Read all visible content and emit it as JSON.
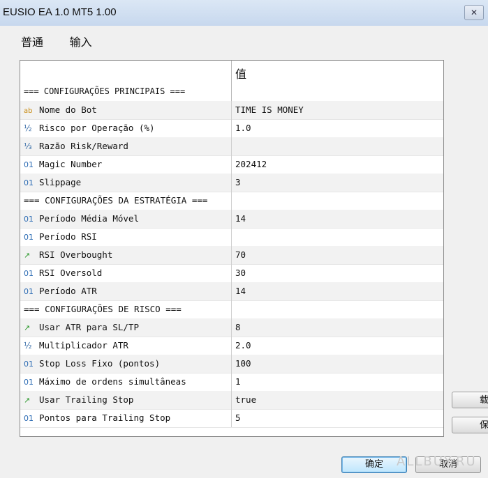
{
  "window": {
    "title": "EUSIO EA 1.0 MT5 1.00",
    "close_glyph": "✕"
  },
  "tabs": [
    {
      "label": "普通"
    },
    {
      "label": "输入"
    }
  ],
  "grid": {
    "value_header": "值",
    "section_main": "=== CONFIGURAÇÕES PRINCIPAIS ===",
    "rows": [
      {
        "icon": "ab",
        "name": "Nome do Bot",
        "value": "TIME IS MONEY"
      },
      {
        "icon": "½",
        "name": "Risco por Operação (%)",
        "value": "1.0"
      },
      {
        "icon": "⅓",
        "name": "Razão Risk/Reward",
        "value": ""
      },
      {
        "icon": "01",
        "name": "Magic Number",
        "value": "202412"
      },
      {
        "icon": "01",
        "name": "Slippage",
        "value": "3"
      },
      {
        "icon": "",
        "name": "=== CONFIGURAÇÕES DA ESTRATÉGIA ===",
        "value": "",
        "section": true
      },
      {
        "icon": "01",
        "name": "Período Média Móvel",
        "value": "14"
      },
      {
        "icon": "01",
        "name": "Período RSI",
        "value": ""
      },
      {
        "icon": "↗",
        "name": "RSI Overbought",
        "value": "70"
      },
      {
        "icon": "01",
        "name": "RSI Oversold",
        "value": "30"
      },
      {
        "icon": "01",
        "name": "Período ATR",
        "value": "14"
      },
      {
        "icon": "",
        "name": "=== CONFIGURAÇÕES DE RISCO ===",
        "value": "",
        "section": true
      },
      {
        "icon": "↗",
        "name": "Usar ATR para SL/TP",
        "value": "8"
      },
      {
        "icon": "½",
        "name": "Multiplicador ATR",
        "value": "2.0"
      },
      {
        "icon": "01",
        "name": "Stop Loss Fixo (pontos)",
        "value": "100"
      },
      {
        "icon": "01",
        "name": "Máximo de ordens simultâneas",
        "value": "1"
      },
      {
        "icon": "↗",
        "name": "Usar Trailing Stop",
        "value": "true"
      },
      {
        "icon": "01",
        "name": "Pontos para Trailing Stop",
        "value": "5"
      }
    ]
  },
  "side_buttons": [
    {
      "label": "载"
    },
    {
      "label": "保"
    }
  ],
  "footer": {
    "ok": "确定",
    "cancel": "取消"
  },
  "watermark": "ALLBUY.RU"
}
